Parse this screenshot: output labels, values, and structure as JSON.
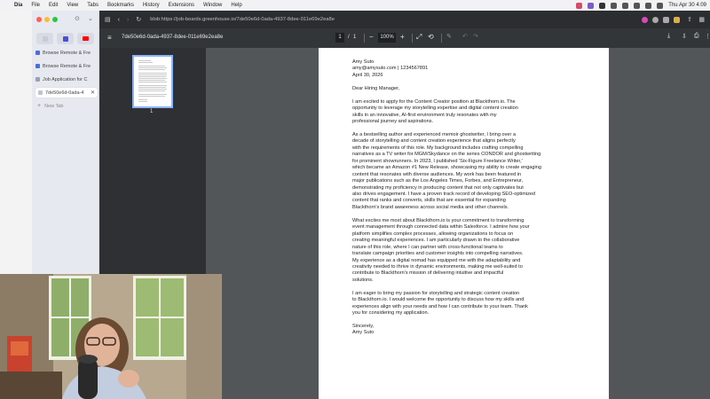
{
  "menubar": {
    "app": "Dia",
    "items": [
      "File",
      "Edit",
      "View",
      "Tabs",
      "Bookmarks",
      "History",
      "Extensions",
      "Window",
      "Help"
    ],
    "datetime": "Thu Apr 30  4:09"
  },
  "sidebar": {
    "tabs": [
      {
        "label": "Browse Remote & Fre"
      },
      {
        "label": "Browse Remote & Fre"
      },
      {
        "label": "Job Application for C"
      },
      {
        "label": "7de50e6d-0ada-4"
      }
    ],
    "new_tab": "New Tab"
  },
  "browser": {
    "url": "blob:https://job-boards.greenhouse.io/7de50e6d-0ada-4937-8dee-011e69e2ea8e"
  },
  "viewer": {
    "title": "7de50e6d-0ada-4937-8dee-011e69e2ea8e",
    "page_current": "1",
    "page_sep": "/",
    "page_total": "1",
    "zoom": "100%",
    "zoom_out": "−",
    "zoom_in": "+",
    "thumb_label": "1"
  },
  "letter": {
    "lines": [
      "Amy Suto",
      "amy@amysuto.com | 1234567891",
      "April 30, 2026",
      "",
      "Dear Hiring Manager,",
      "",
      "I am excited to apply for the Content Creator position at Blackthorn.io. The",
      "opportunity to leverage my storytelling expertise and digital content creation",
      "skills in an innovative, AI-first environment truly resonates with my",
      "professional journey and aspirations.",
      "",
      "As a bestselling author and experienced memoir ghostwriter, I bring over a",
      "decade of storytelling and content creation experience that aligns perfectly",
      "with the requirements of this role. My background includes crafting compelling",
      "narratives as a TV writer for MGM/Skydance on the series CONDOR and ghostwriting",
      "for prominent showrunners. In 2023, I published 'Six-Figure Freelance Writer,'",
      "which became an Amazon #1 New Release, showcasing my ability to create engaging",
      "content that resonates with diverse audiences. My work has been featured in",
      "major publications such as the Los Angeles Times, Forbes, and Entrepreneur,",
      "demonstrating my proficiency in producing content that not only captivates but",
      "also drives engagement. I have a proven track record of developing SEO-optimized",
      "content that ranks and converts, skills that are essential for expanding",
      "Blackthorn's brand awareness across social media and other channels.",
      "",
      "What excites me most about Blackthorn.io is your commitment to transforming",
      "event management through connected data within Salesforce. I admire how your",
      "platform simplifies complex processes, allowing organizations to focus on",
      "creating meaningful experiences. I am particularly drawn to the collaborative",
      "nature of this role, where I can partner with cross-functional teams to",
      "translate campaign priorities and customer insights into compelling narratives.",
      "My experience as a digital nomad has equipped me with the adaptability and",
      "creativity needed to thrive in dynamic environments, making me well-suited to",
      "contribute to Blackthorn's mission of delivering intuitive and impactful",
      "solutions.",
      "",
      "I am eager to bring my passion for storytelling and strategic content creation",
      "to Blackthorn.io. I would welcome the opportunity to discuss how my skills and",
      "experiences align with your needs and how I can contribute to your team. Thank",
      "you for considering my application.",
      "",
      "Sincerely,",
      "Amy Suto"
    ]
  }
}
